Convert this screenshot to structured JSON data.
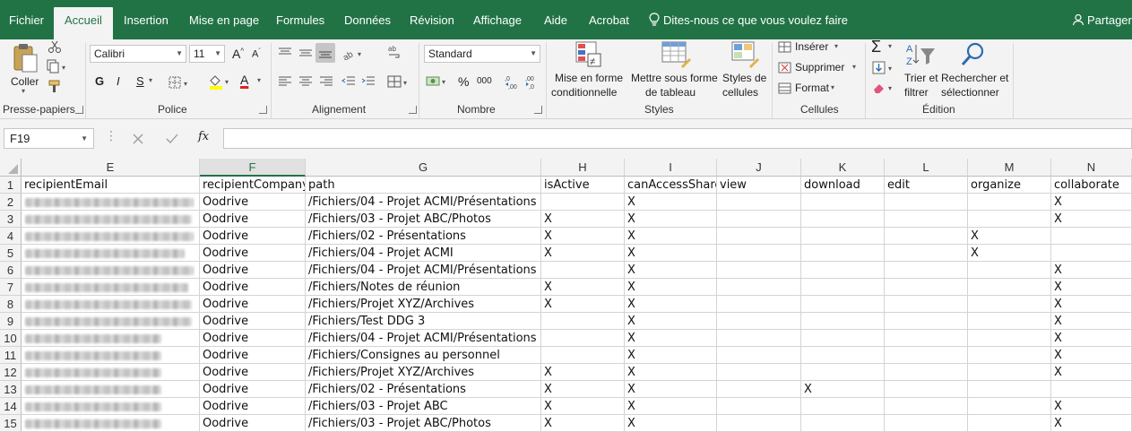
{
  "menu": {
    "tabs": [
      "Fichier",
      "Accueil",
      "Insertion",
      "Mise en page",
      "Formules",
      "Données",
      "Révision",
      "Affichage",
      "Aide",
      "Acrobat"
    ],
    "active": "Accueil",
    "tell_me": "Dites-nous ce que vous voulez faire",
    "share": "Partager"
  },
  "ribbon": {
    "clipboard": {
      "paste": "Coller",
      "label": "Presse-papiers"
    },
    "font": {
      "name": "Calibri",
      "size": "11",
      "bold": "G",
      "italic": "I",
      "underline": "S",
      "grow": "A",
      "shrink": "A",
      "color_letter": "A",
      "label": "Police"
    },
    "alignment": {
      "label": "Alignement"
    },
    "number": {
      "format": "Standard",
      "percent": "%",
      "thousands": "000",
      "label": "Nombre"
    },
    "styles": {
      "conditional": [
        "Mise en forme",
        "conditionnelle"
      ],
      "table": [
        "Mettre sous forme",
        "de tableau"
      ],
      "cell_styles": [
        "Styles de",
        "cellules"
      ],
      "label": "Styles"
    },
    "cells": {
      "insert": "Insérer",
      "delete": "Supprimer",
      "format": "Format",
      "label": "Cellules"
    },
    "editing": {
      "sort": [
        "Trier et",
        "filtrer"
      ],
      "find": [
        "Rechercher et",
        "sélectionner"
      ],
      "label": "Édition"
    }
  },
  "formula_bar": {
    "name_box": "F19",
    "formula": ""
  },
  "colors": {
    "excel_green": "#217346",
    "selected_header": "#e1e1e1"
  },
  "sheet": {
    "columns": [
      "E",
      "F",
      "G",
      "H",
      "I",
      "J",
      "K",
      "L",
      "M",
      "N"
    ],
    "selected_column": "F",
    "rows": [
      {
        "n": "1",
        "cells": [
          "recipientEmail",
          "recipientCompany",
          "path",
          "isActive",
          "canAccessShare",
          "view",
          "download",
          "edit",
          "organize",
          "collaborate"
        ]
      },
      {
        "n": "2",
        "cells": [
          "",
          "Oodrive",
          "/Fichiers/04 - Projet ACMI/Présentations",
          "",
          "X",
          "",
          "",
          "",
          "",
          "X"
        ]
      },
      {
        "n": "3",
        "cells": [
          "",
          "Oodrive",
          "/Fichiers/03 - Projet ABC/Photos",
          "X",
          "X",
          "",
          "",
          "",
          "",
          "X"
        ]
      },
      {
        "n": "4",
        "cells": [
          "",
          "Oodrive",
          "/Fichiers/02 - Présentations",
          "X",
          "X",
          "",
          "",
          "",
          "X",
          ""
        ]
      },
      {
        "n": "5",
        "cells": [
          "",
          "Oodrive",
          "/Fichiers/04 - Projet ACMI",
          "X",
          "X",
          "",
          "",
          "",
          "X",
          ""
        ]
      },
      {
        "n": "6",
        "cells": [
          "",
          "Oodrive",
          "/Fichiers/04 - Projet ACMI/Présentations",
          "",
          "X",
          "",
          "",
          "",
          "",
          "X"
        ]
      },
      {
        "n": "7",
        "cells": [
          "",
          "Oodrive",
          "/Fichiers/Notes de réunion",
          "X",
          "X",
          "",
          "",
          "",
          "",
          "X"
        ]
      },
      {
        "n": "8",
        "cells": [
          "",
          "Oodrive",
          "/Fichiers/Projet XYZ/Archives",
          "X",
          "X",
          "",
          "",
          "",
          "",
          "X"
        ]
      },
      {
        "n": "9",
        "cells": [
          "",
          "Oodrive",
          "/Fichiers/Test DDG 3",
          "",
          "X",
          "",
          "",
          "",
          "",
          "X"
        ]
      },
      {
        "n": "10",
        "cells": [
          "",
          "Oodrive",
          "/Fichiers/04 - Projet ACMI/Présentations",
          "",
          "X",
          "",
          "",
          "",
          "",
          "X"
        ]
      },
      {
        "n": "11",
        "cells": [
          "",
          "Oodrive",
          "/Fichiers/Consignes au personnel",
          "",
          "X",
          "",
          "",
          "",
          "",
          "X"
        ]
      },
      {
        "n": "12",
        "cells": [
          "",
          "Oodrive",
          "/Fichiers/Projet XYZ/Archives",
          "X",
          "X",
          "",
          "",
          "",
          "",
          "X"
        ]
      },
      {
        "n": "13",
        "cells": [
          "",
          "Oodrive",
          "/Fichiers/02 - Présentations",
          "X",
          "X",
          "",
          "X",
          "",
          "",
          ""
        ]
      },
      {
        "n": "14",
        "cells": [
          "",
          "Oodrive",
          "/Fichiers/03 - Projet ABC",
          "X",
          "X",
          "",
          "",
          "",
          "",
          "X"
        ]
      },
      {
        "n": "15",
        "cells": [
          "",
          "Oodrive",
          "/Fichiers/03 - Projet ABC/Photos",
          "X",
          "X",
          "",
          "",
          "",
          "",
          "X"
        ]
      }
    ]
  }
}
